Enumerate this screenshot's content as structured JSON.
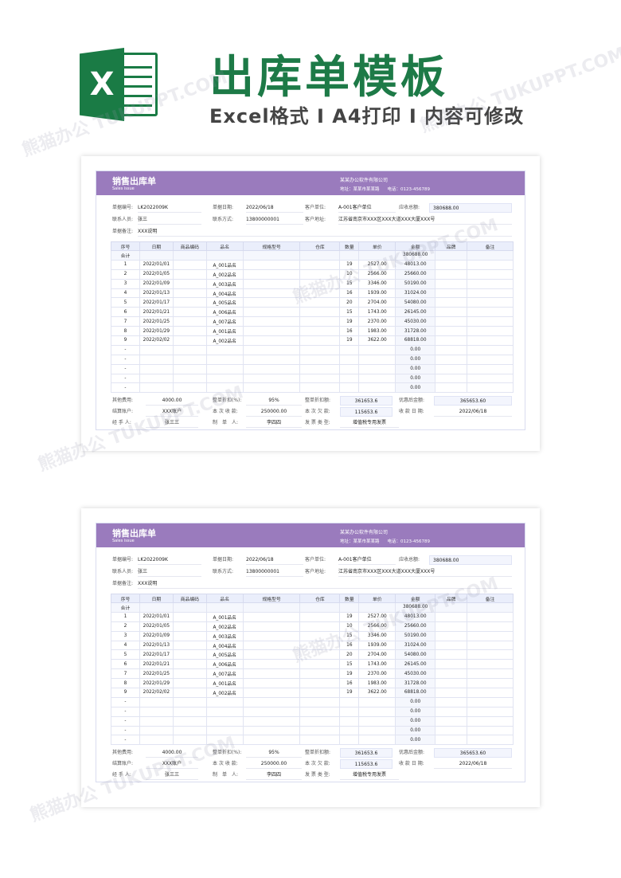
{
  "banner": {
    "logo_letter": "X",
    "title": "出库单模板",
    "subtitle": "Excel格式 I A4打印 I 内容可修改"
  },
  "form": {
    "title_cn": "销售出库单",
    "title_en": "Sales issue",
    "company": "某某办公软件有限公司",
    "address": "地址：某某市某某路",
    "phone": "电话：0123-456789",
    "labels": {
      "doc_no": "单据编号:",
      "doc_date": "单据日期:",
      "customer": "客户单位:",
      "receivable": "应收总额:",
      "contact": "联系人员:",
      "method": "联系方式:",
      "cust_addr": "客户地址:",
      "remark": "单据备注:"
    },
    "values": {
      "doc_no": "LK2022009K",
      "doc_date": "2022/06/18",
      "customer": "A-001客户单位",
      "receivable": "380688.00",
      "contact": "张三",
      "method": "13800000001",
      "cust_addr": "江苏省南京市XXX区XXX大道XXX大厦XXX号",
      "remark": "XXX说明"
    },
    "columns": [
      "序号",
      "日期",
      "商品编码",
      "品名",
      "规格型号",
      "仓库",
      "数量",
      "单价",
      "金额",
      "品牌",
      "备注"
    ],
    "total_label": "合计",
    "total_amount": "380688.00",
    "rows": [
      {
        "no": "1",
        "date": "2022/01/01",
        "name": "A_001品名",
        "qty": "19",
        "price": "2527.00",
        "amount": "48013.00"
      },
      {
        "no": "2",
        "date": "2022/01/05",
        "name": "A_002品名",
        "qty": "10",
        "price": "2566.00",
        "amount": "25660.00"
      },
      {
        "no": "3",
        "date": "2022/01/09",
        "name": "A_003品名",
        "qty": "15",
        "price": "3346.00",
        "amount": "50190.00"
      },
      {
        "no": "4",
        "date": "2022/01/13",
        "name": "A_004品名",
        "qty": "16",
        "price": "1939.00",
        "amount": "31024.00"
      },
      {
        "no": "5",
        "date": "2022/01/17",
        "name": "A_005品名",
        "qty": "20",
        "price": "2704.00",
        "amount": "54080.00"
      },
      {
        "no": "6",
        "date": "2022/01/21",
        "name": "A_006品名",
        "qty": "15",
        "price": "1743.00",
        "amount": "26145.00"
      },
      {
        "no": "7",
        "date": "2022/01/25",
        "name": "A_007品名",
        "qty": "19",
        "price": "2370.00",
        "amount": "45030.00"
      },
      {
        "no": "8",
        "date": "2022/01/29",
        "name": "A_001品名",
        "qty": "16",
        "price": "1983.00",
        "amount": "31728.00"
      },
      {
        "no": "9",
        "date": "2022/02/02",
        "name": "A_002品名",
        "qty": "19",
        "price": "3622.00",
        "amount": "68818.00"
      },
      {
        "no": "-",
        "date": "",
        "name": "",
        "qty": "",
        "price": "",
        "amount": "0.00"
      },
      {
        "no": "-",
        "date": "",
        "name": "",
        "qty": "",
        "price": "",
        "amount": "0.00"
      },
      {
        "no": "-",
        "date": "",
        "name": "",
        "qty": "",
        "price": "",
        "amount": "0.00"
      },
      {
        "no": "-",
        "date": "",
        "name": "",
        "qty": "",
        "price": "",
        "amount": "0.00"
      },
      {
        "no": "-",
        "date": "",
        "name": "",
        "qty": "",
        "price": "",
        "amount": "0.00"
      }
    ],
    "footer": {
      "other_fee_label": "其他费用:",
      "other_fee": "4000.00",
      "discount_rate_label": "整单折扣(%):",
      "discount_rate": "95%",
      "discount_amount_label": "整单折扣额:",
      "discount_amount": "361653.6",
      "after_discount_label": "优惠后金额:",
      "after_discount": "365653.60",
      "account_label": "结算账户:",
      "account": "XXX账户",
      "received_label": "本 次 收 款:",
      "received": "250000.00",
      "owed_label": "本 次 欠 款:",
      "owed": "115653.6",
      "receive_date_label": "收 款 日 期:",
      "receive_date": "2022/06/18",
      "handler_label": "经 手 人:",
      "handler": "张三三",
      "maker_label": "制　单　人:",
      "maker": "李四四",
      "invoice_label": "发 票 类 型:",
      "invoice": "增值税专用发票"
    }
  },
  "watermark": "熊猫办公 TUKUPPT.COM"
}
